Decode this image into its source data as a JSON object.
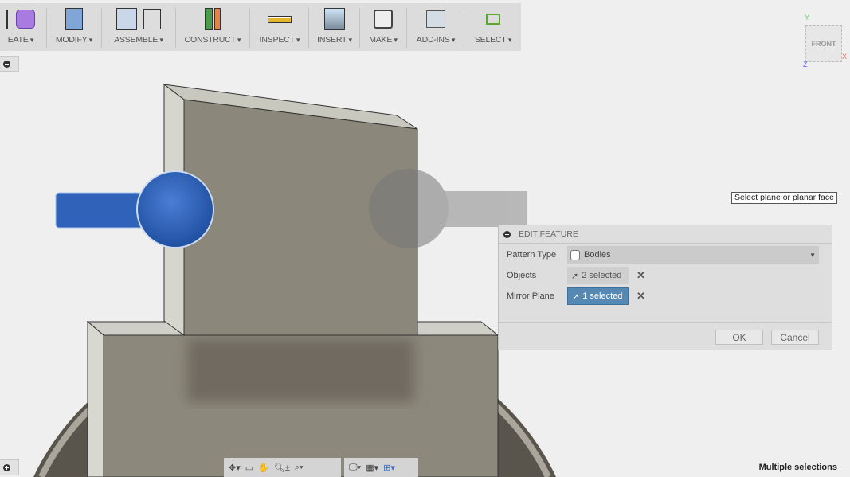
{
  "toolbar": {
    "groups": [
      {
        "label": "EATE",
        "icons": [
          "extrude-icon",
          "form-icon"
        ]
      },
      {
        "label": "MODIFY",
        "icons": [
          "press-pull-icon"
        ]
      },
      {
        "label": "ASSEMBLE",
        "icons": [
          "new-component-icon",
          "joint-icon"
        ]
      },
      {
        "label": "CONSTRUCT",
        "icons": [
          "offset-plane-icon"
        ]
      },
      {
        "label": "INSPECT",
        "icons": [
          "measure-icon"
        ]
      },
      {
        "label": "INSERT",
        "icons": [
          "insert-image-icon"
        ]
      },
      {
        "label": "MAKE",
        "icons": [
          "3d-print-icon"
        ]
      },
      {
        "label": "ADD-INS",
        "icons": [
          "scripts-icon"
        ]
      },
      {
        "label": "SELECT",
        "icons": [
          "select-icon"
        ]
      }
    ]
  },
  "viewcube": {
    "face": "FRONT",
    "axes": {
      "y": "Y",
      "x": "X",
      "z": "Z"
    }
  },
  "tooltip": "Select plane or planar face",
  "dialog": {
    "title": "EDIT FEATURE",
    "pattern_type": {
      "label": "Pattern Type",
      "value": "Bodies"
    },
    "objects": {
      "label": "Objects",
      "value": "2 selected"
    },
    "mirror_plane": {
      "label": "Mirror Plane",
      "value": "1 selected"
    },
    "ok": "OK",
    "cancel": "Cancel"
  },
  "status": "Multiple selections",
  "colors": {
    "selection_blue": "#2f62b8",
    "active_input": "#5688b4",
    "body": "#8c877b"
  }
}
